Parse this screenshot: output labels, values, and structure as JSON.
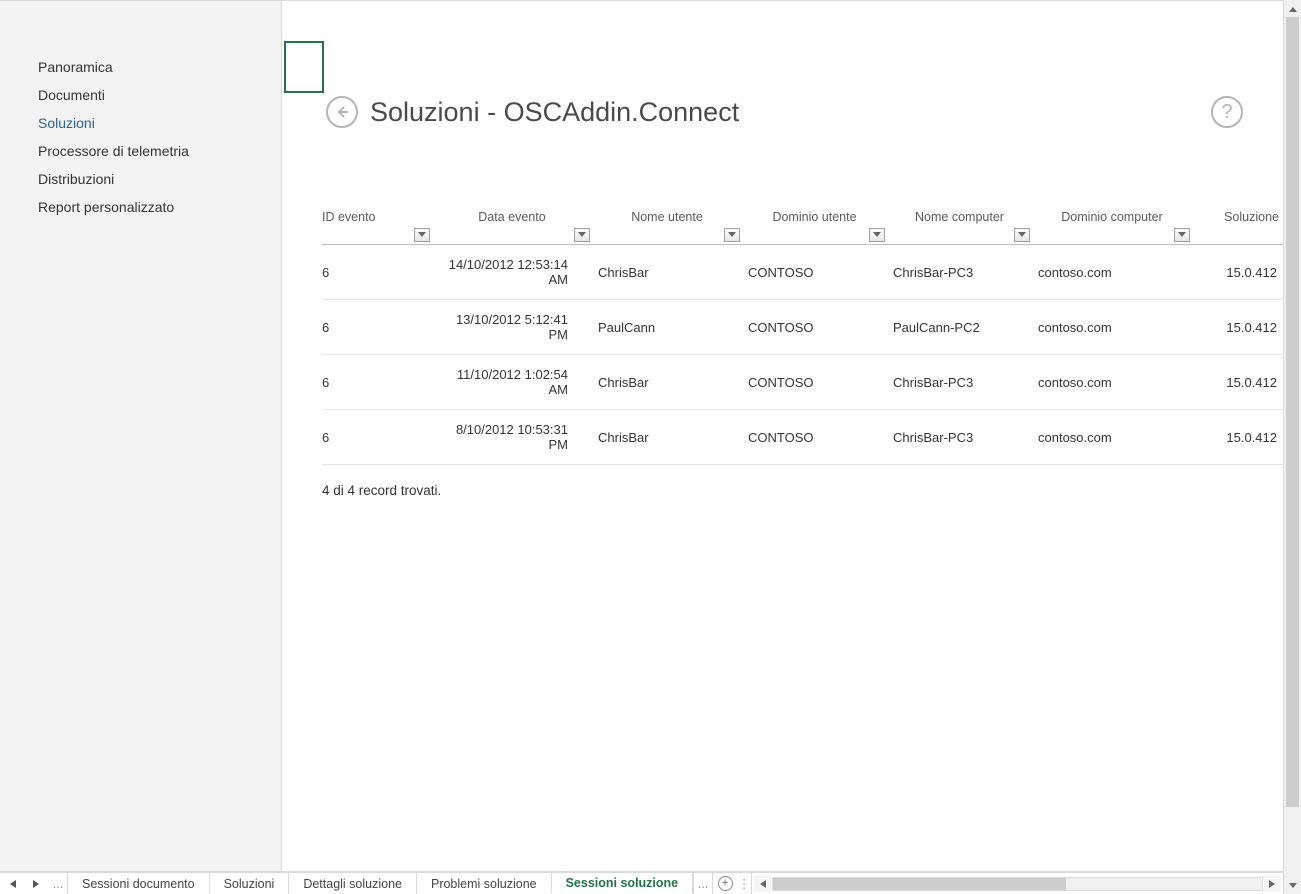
{
  "sidebar": {
    "items": [
      {
        "label": "Panoramica",
        "active": false
      },
      {
        "label": "Documenti",
        "active": false
      },
      {
        "label": "Soluzioni",
        "active": true
      },
      {
        "label": "Processore di telemetria",
        "active": false
      },
      {
        "label": "Distribuzioni",
        "active": false
      },
      {
        "label": "Report personalizzato",
        "active": false
      }
    ]
  },
  "header": {
    "title": "Soluzioni - OSCAddin.Connect"
  },
  "table": {
    "columns": [
      "ID evento",
      "Data evento",
      "Nome utente",
      "Dominio utente",
      "Nome computer",
      "Dominio computer",
      "Soluzione"
    ],
    "rows": [
      {
        "id": "6",
        "date": "14/10/2012 12:53:14 AM",
        "user": "ChrisBar",
        "udom": "CONTOSO",
        "comp": "ChrisBar-PC3",
        "cdom": "contoso.com",
        "sol": "15.0.412"
      },
      {
        "id": "6",
        "date": "13/10/2012 5:12:41 PM",
        "user": "PaulCann",
        "udom": "CONTOSO",
        "comp": "PaulCann-PC2",
        "cdom": "contoso.com",
        "sol": "15.0.412"
      },
      {
        "id": "6",
        "date": "11/10/2012 1:02:54 AM",
        "user": "ChrisBar",
        "udom": "CONTOSO",
        "comp": "ChrisBar-PC3",
        "cdom": "contoso.com",
        "sol": "15.0.412"
      },
      {
        "id": "6",
        "date": "8/10/2012 10:53:31 PM",
        "user": "ChrisBar",
        "udom": "CONTOSO",
        "comp": "ChrisBar-PC3",
        "cdom": "contoso.com",
        "sol": "15.0.412"
      }
    ]
  },
  "footer": {
    "records_text": "4 di 4 record trovati."
  },
  "tabs": {
    "items": [
      {
        "label": "Sessioni documento",
        "active": false
      },
      {
        "label": "Soluzioni",
        "active": false
      },
      {
        "label": "Dettagli soluzione",
        "active": false
      },
      {
        "label": "Problemi soluzione",
        "active": false
      },
      {
        "label": "Sessioni soluzione",
        "active": true
      }
    ],
    "more_label": "..."
  }
}
